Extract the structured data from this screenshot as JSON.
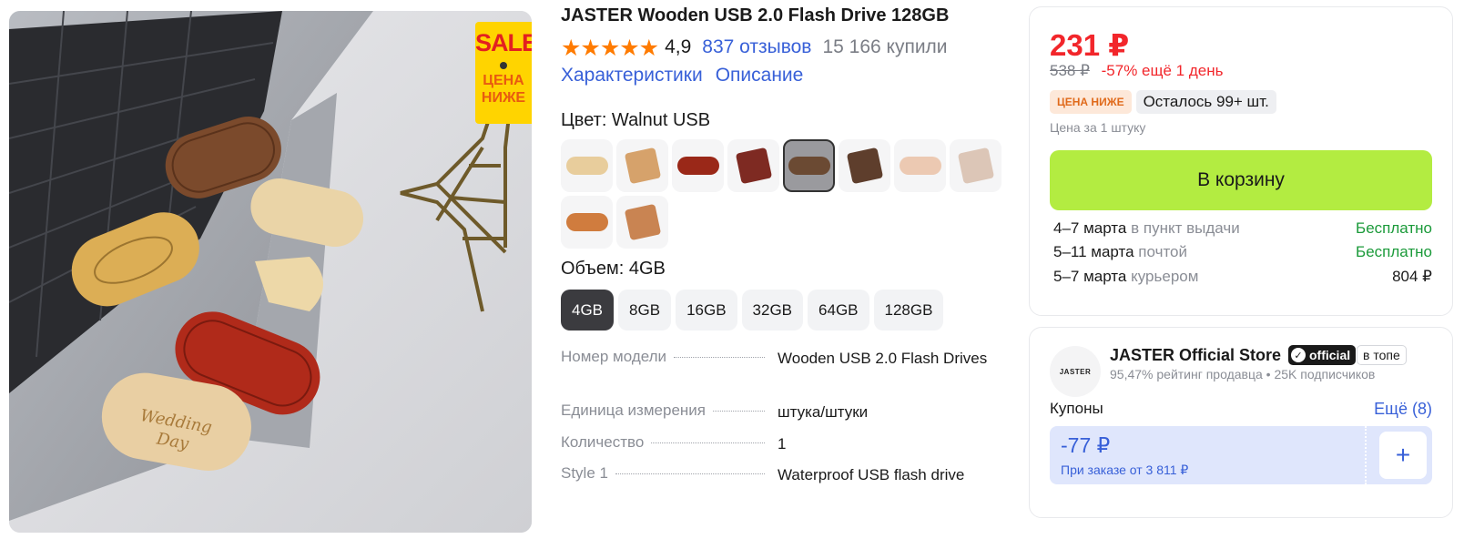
{
  "image": {
    "alt_icon": "usb-photo",
    "sale_tag": {
      "sale": "SALE",
      "lower": "ЦЕНА НИЖЕ"
    }
  },
  "product": {
    "title": "JASTER Wooden USB 2.0 Flash Drive 128GB",
    "stars": "★★★★★",
    "rating": "4,9",
    "reviews": "837 отзывов",
    "bought": "15 166 купили",
    "links": [
      "Характеристики",
      "Описание"
    ]
  },
  "color": {
    "label": "Цвет: Walnut USB",
    "swatches": [
      {
        "kind": "stick",
        "color": "#e8cd9c"
      },
      {
        "kind": "box",
        "color": "#d6a26b"
      },
      {
        "kind": "stick",
        "color": "#9a2818"
      },
      {
        "kind": "box",
        "color": "#7e2a22"
      },
      {
        "kind": "stick",
        "color": "#6b4a33",
        "selected": true
      },
      {
        "kind": "box",
        "color": "#5e3e2c"
      },
      {
        "kind": "stick",
        "color": "#ecc9b2"
      },
      {
        "kind": "box",
        "color": "#dcc6b7"
      },
      {
        "kind": "stick",
        "color": "#d07c3e"
      },
      {
        "kind": "box",
        "color": "#c98452"
      }
    ]
  },
  "volume": {
    "label": "Объем: 4GB",
    "options": [
      "4GB",
      "8GB",
      "16GB",
      "32GB",
      "64GB",
      "128GB"
    ],
    "selected": "4GB"
  },
  "specs": [
    {
      "key": "Номер модели",
      "value": "Wooden USB 2.0 Flash Drives"
    },
    {
      "key": "Единица измерения",
      "value": "штука/штуки"
    },
    {
      "key": "Количество",
      "value": "1"
    },
    {
      "key": "Style 1",
      "value": "Waterproof USB flash drive"
    }
  ],
  "offer": {
    "price": "231 ₽",
    "old_price": "538 ₽",
    "discount": "-57% ещё 1 день",
    "badge_low": "ЦЕНА НИЖЕ",
    "badge_left": "Осталось 99+ шт.",
    "unit": "Цена за 1 штуку",
    "cart": "В корзину",
    "delivery": [
      {
        "date": "4–7 марта",
        "how": "в пункт выдачи",
        "cost": "Бесплатно",
        "free": true
      },
      {
        "date": "5–11 марта",
        "how": "почтой",
        "cost": "Бесплатно",
        "free": true
      },
      {
        "date": "5–7 марта",
        "how": "курьером",
        "cost": "804 ₽",
        "free": false
      }
    ]
  },
  "store": {
    "logo": "JASTER",
    "name": "JASTER Official Store",
    "official": "official",
    "top": "в топе",
    "rating": "95,47% рейтинг продавца",
    "subscribers": "25K подписчиков",
    "coupons_label": "Купоны",
    "coupons_more": "Ещё (8)",
    "coupon": {
      "amount": "-77 ₽",
      "condition": "При заказе от 3 811 ₽"
    }
  },
  "colors": {
    "accent": "#3860d8",
    "price": "#f2262b",
    "cart": "#b3ec41",
    "free": "#1b9a3a",
    "stars": "#ff7b00"
  }
}
